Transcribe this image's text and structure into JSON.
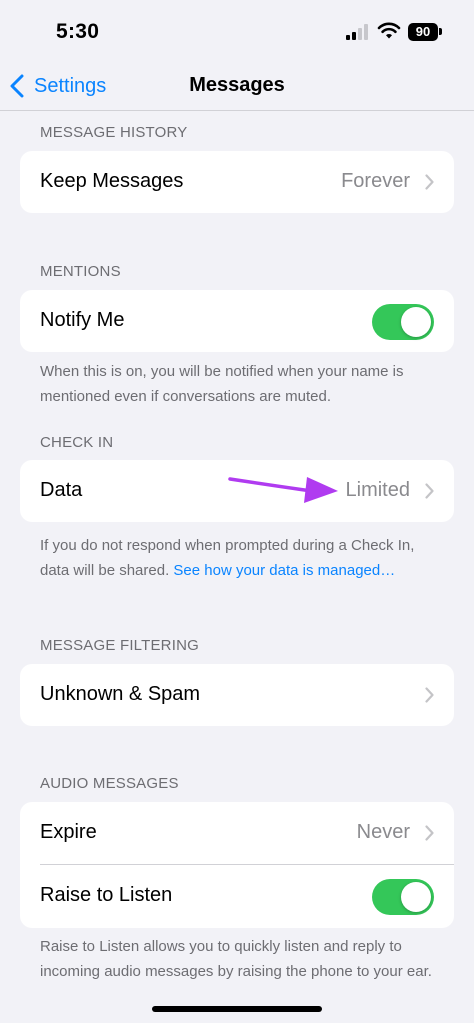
{
  "status": {
    "time": "5:30",
    "battery": "90"
  },
  "nav": {
    "back_label": "Settings",
    "title": "Messages"
  },
  "history": {
    "header": "MESSAGE HISTORY",
    "keep_label": "Keep Messages",
    "keep_value": "Forever"
  },
  "mentions": {
    "header": "MENTIONS",
    "notify_label": "Notify Me",
    "notify_on": true,
    "footnote": "When this is on, you will be notified when your name is mentioned even if conversations are muted."
  },
  "checkin": {
    "header": "CHECK IN",
    "data_label": "Data",
    "data_value": "Limited",
    "footnote_text": "If you do not respond when prompted during a Check In, data will be shared. ",
    "footnote_link": "See how your data is managed…"
  },
  "filtering": {
    "header": "MESSAGE FILTERING",
    "unknown_label": "Unknown & Spam"
  },
  "audio": {
    "header": "AUDIO MESSAGES",
    "expire_label": "Expire",
    "expire_value": "Never",
    "raise_label": "Raise to Listen",
    "raise_on": true,
    "footnote": "Raise to Listen allows you to quickly listen and reply to incoming audio messages by raising the phone to your ear."
  },
  "colors": {
    "accent": "#0a84ff",
    "toggle_on": "#34c759",
    "annotation_arrow": "#b03bf0",
    "background": "#f2f2f7"
  }
}
